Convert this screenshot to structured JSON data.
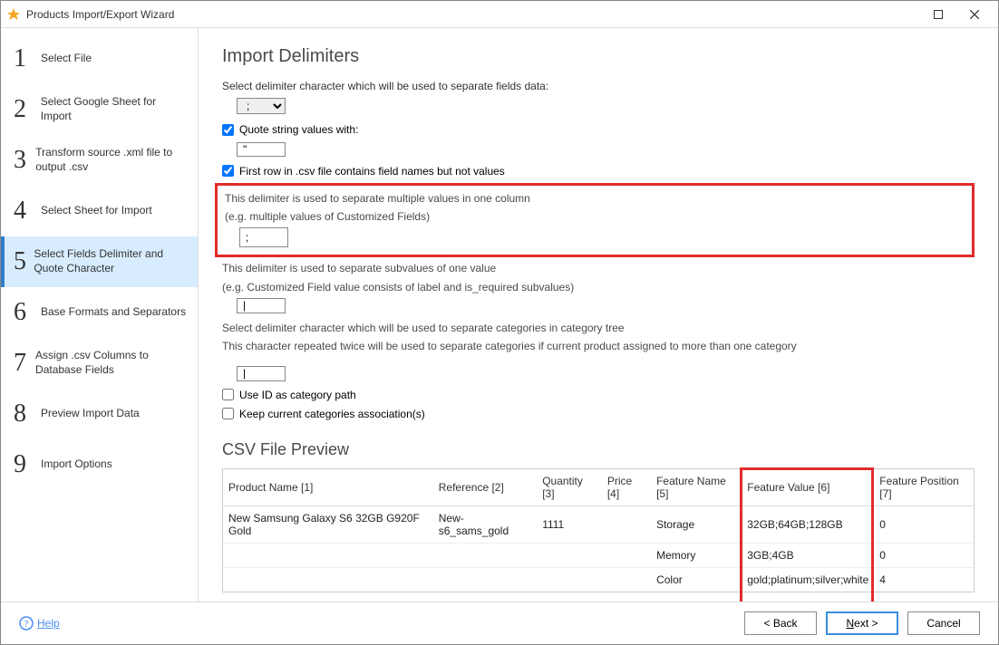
{
  "window": {
    "title": "Products Import/Export Wizard"
  },
  "sidebar": {
    "steps": [
      {
        "num": "1",
        "label": "Select File"
      },
      {
        "num": "2",
        "label": "Select Google Sheet for Import"
      },
      {
        "num": "3",
        "label": "Transform source .xml file to output .csv"
      },
      {
        "num": "4",
        "label": "Select Sheet for Import"
      },
      {
        "num": "5",
        "label": "Select Fields Delimiter and Quote Character"
      },
      {
        "num": "6",
        "label": "Base Formats and Separators"
      },
      {
        "num": "7",
        "label": "Assign .csv Columns to Database Fields"
      },
      {
        "num": "8",
        "label": "Preview Import Data"
      },
      {
        "num": "9",
        "label": "Import Options"
      }
    ],
    "active_index": 4
  },
  "main": {
    "title": "Import Delimiters",
    "delimiter_instr": "Select delimiter character which will be used to separate fields data:",
    "delimiter_value": ";",
    "quote_label": "Quote string values with:",
    "quote_value": "\"",
    "first_row_label": "First row in .csv file contains field names but not values",
    "multi_value_note1": "This delimiter is used to separate multiple values in one column",
    "multi_value_note2": "(e.g. multiple values of Customized Fields)",
    "multi_value_value": ";",
    "subvalue_note1": "This delimiter is used to separate subvalues of one value",
    "subvalue_note2": "(e.g. Customized Field value consists of label and is_required subvalues)",
    "subvalue_value": "|",
    "category_note1": "Select delimiter character which will be used to separate categories in category tree",
    "category_note2": "This character repeated twice will be used to separate categories if current product assigned to more than one category",
    "category_value": "|",
    "use_id_label": "Use ID as category path",
    "keep_assoc_label": "Keep current categories association(s)",
    "preview_title": "CSV File Preview",
    "preview_headers": [
      "Product Name [1]",
      "Reference [2]",
      "Quantity [3]",
      "Price [4]",
      "Feature Name [5]",
      "Feature Value [6]",
      "Feature Position [7]"
    ],
    "preview_rows": [
      [
        "New Samsung Galaxy S6 32GB G920F Gold",
        "New-s6_sams_gold",
        "1111",
        "",
        "Storage",
        "32GB;64GB;128GB",
        "0"
      ],
      [
        "",
        "",
        "",
        "",
        "Memory",
        "3GB;4GB",
        "0"
      ],
      [
        "",
        "",
        "",
        "",
        "Color",
        "gold;platinum;silver;white",
        "4"
      ]
    ]
  },
  "footer": {
    "help": "Help",
    "back": "< Back",
    "next_prefix": "N",
    "next_rest": "ext >",
    "cancel": "Cancel"
  }
}
